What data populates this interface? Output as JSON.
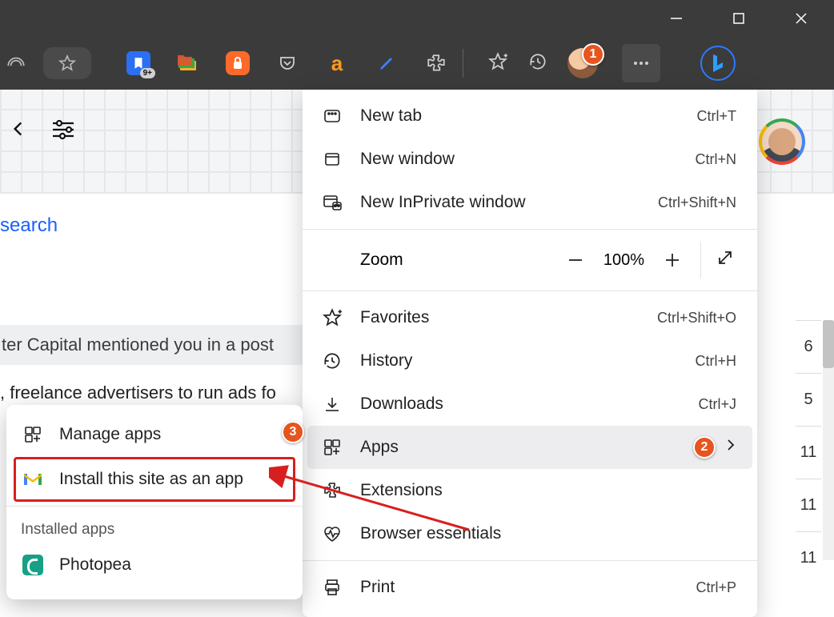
{
  "titlebar": {
    "minimize": "—",
    "maximize": "▢",
    "close": "✕"
  },
  "toolbar": {
    "badge": "9+",
    "extensions": [
      "saver",
      "folders",
      "vpn",
      "pocket",
      "a",
      "pen",
      "puzzle"
    ]
  },
  "page": {
    "search_link": "search",
    "post_text": "ter Capital mentioned you in a post",
    "ads_text": ", freelance advertisers to run ads fo",
    "side_values": [
      "6",
      "5",
      "11",
      "11",
      "11"
    ]
  },
  "menu": {
    "new_tab": {
      "label": "New tab",
      "shortcut": "Ctrl+T"
    },
    "new_window": {
      "label": "New window",
      "shortcut": "Ctrl+N"
    },
    "new_inprivate": {
      "label": "New InPrivate window",
      "shortcut": "Ctrl+Shift+N"
    },
    "zoom": {
      "label": "Zoom",
      "value": "100%"
    },
    "favorites": {
      "label": "Favorites",
      "shortcut": "Ctrl+Shift+O"
    },
    "history": {
      "label": "History",
      "shortcut": "Ctrl+H"
    },
    "downloads": {
      "label": "Downloads",
      "shortcut": "Ctrl+J"
    },
    "apps": {
      "label": "Apps"
    },
    "extensions_row": {
      "label": "Extensions"
    },
    "browser_essentials": {
      "label": "Browser essentials"
    },
    "print": {
      "label": "Print",
      "shortcut": "Ctrl+P"
    }
  },
  "submenu": {
    "manage": "Manage apps",
    "install": "Install this site as an app",
    "installed_label": "Installed apps",
    "app1": "Photopea"
  },
  "annotations": {
    "a1": "1",
    "a2": "2",
    "a3": "3"
  }
}
